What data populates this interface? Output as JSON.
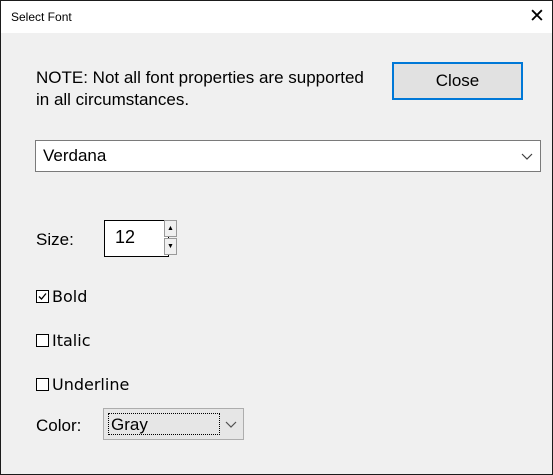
{
  "window": {
    "title": "Select Font",
    "close_glyph": "✕"
  },
  "note": "NOTE: Not all font properties are supported in all circumstances.",
  "close_button": {
    "label": "Close"
  },
  "font_select": {
    "value": "Verdana",
    "icon": "chevron-down-icon"
  },
  "size": {
    "label": "Size:",
    "value": "12",
    "up_glyph": "▲",
    "down_glyph": "▼"
  },
  "options": [
    {
      "label": "Bold",
      "checked": true
    },
    {
      "label": "Italic",
      "checked": false
    },
    {
      "label": "Underline",
      "checked": false
    }
  ],
  "color": {
    "label": "Color:",
    "value": "Gray",
    "icon": "chevron-down-icon"
  },
  "colors": {
    "accent": "#0078d7",
    "dialog_bg": "#f0f0f0",
    "button_bg": "#e1e1e1"
  }
}
